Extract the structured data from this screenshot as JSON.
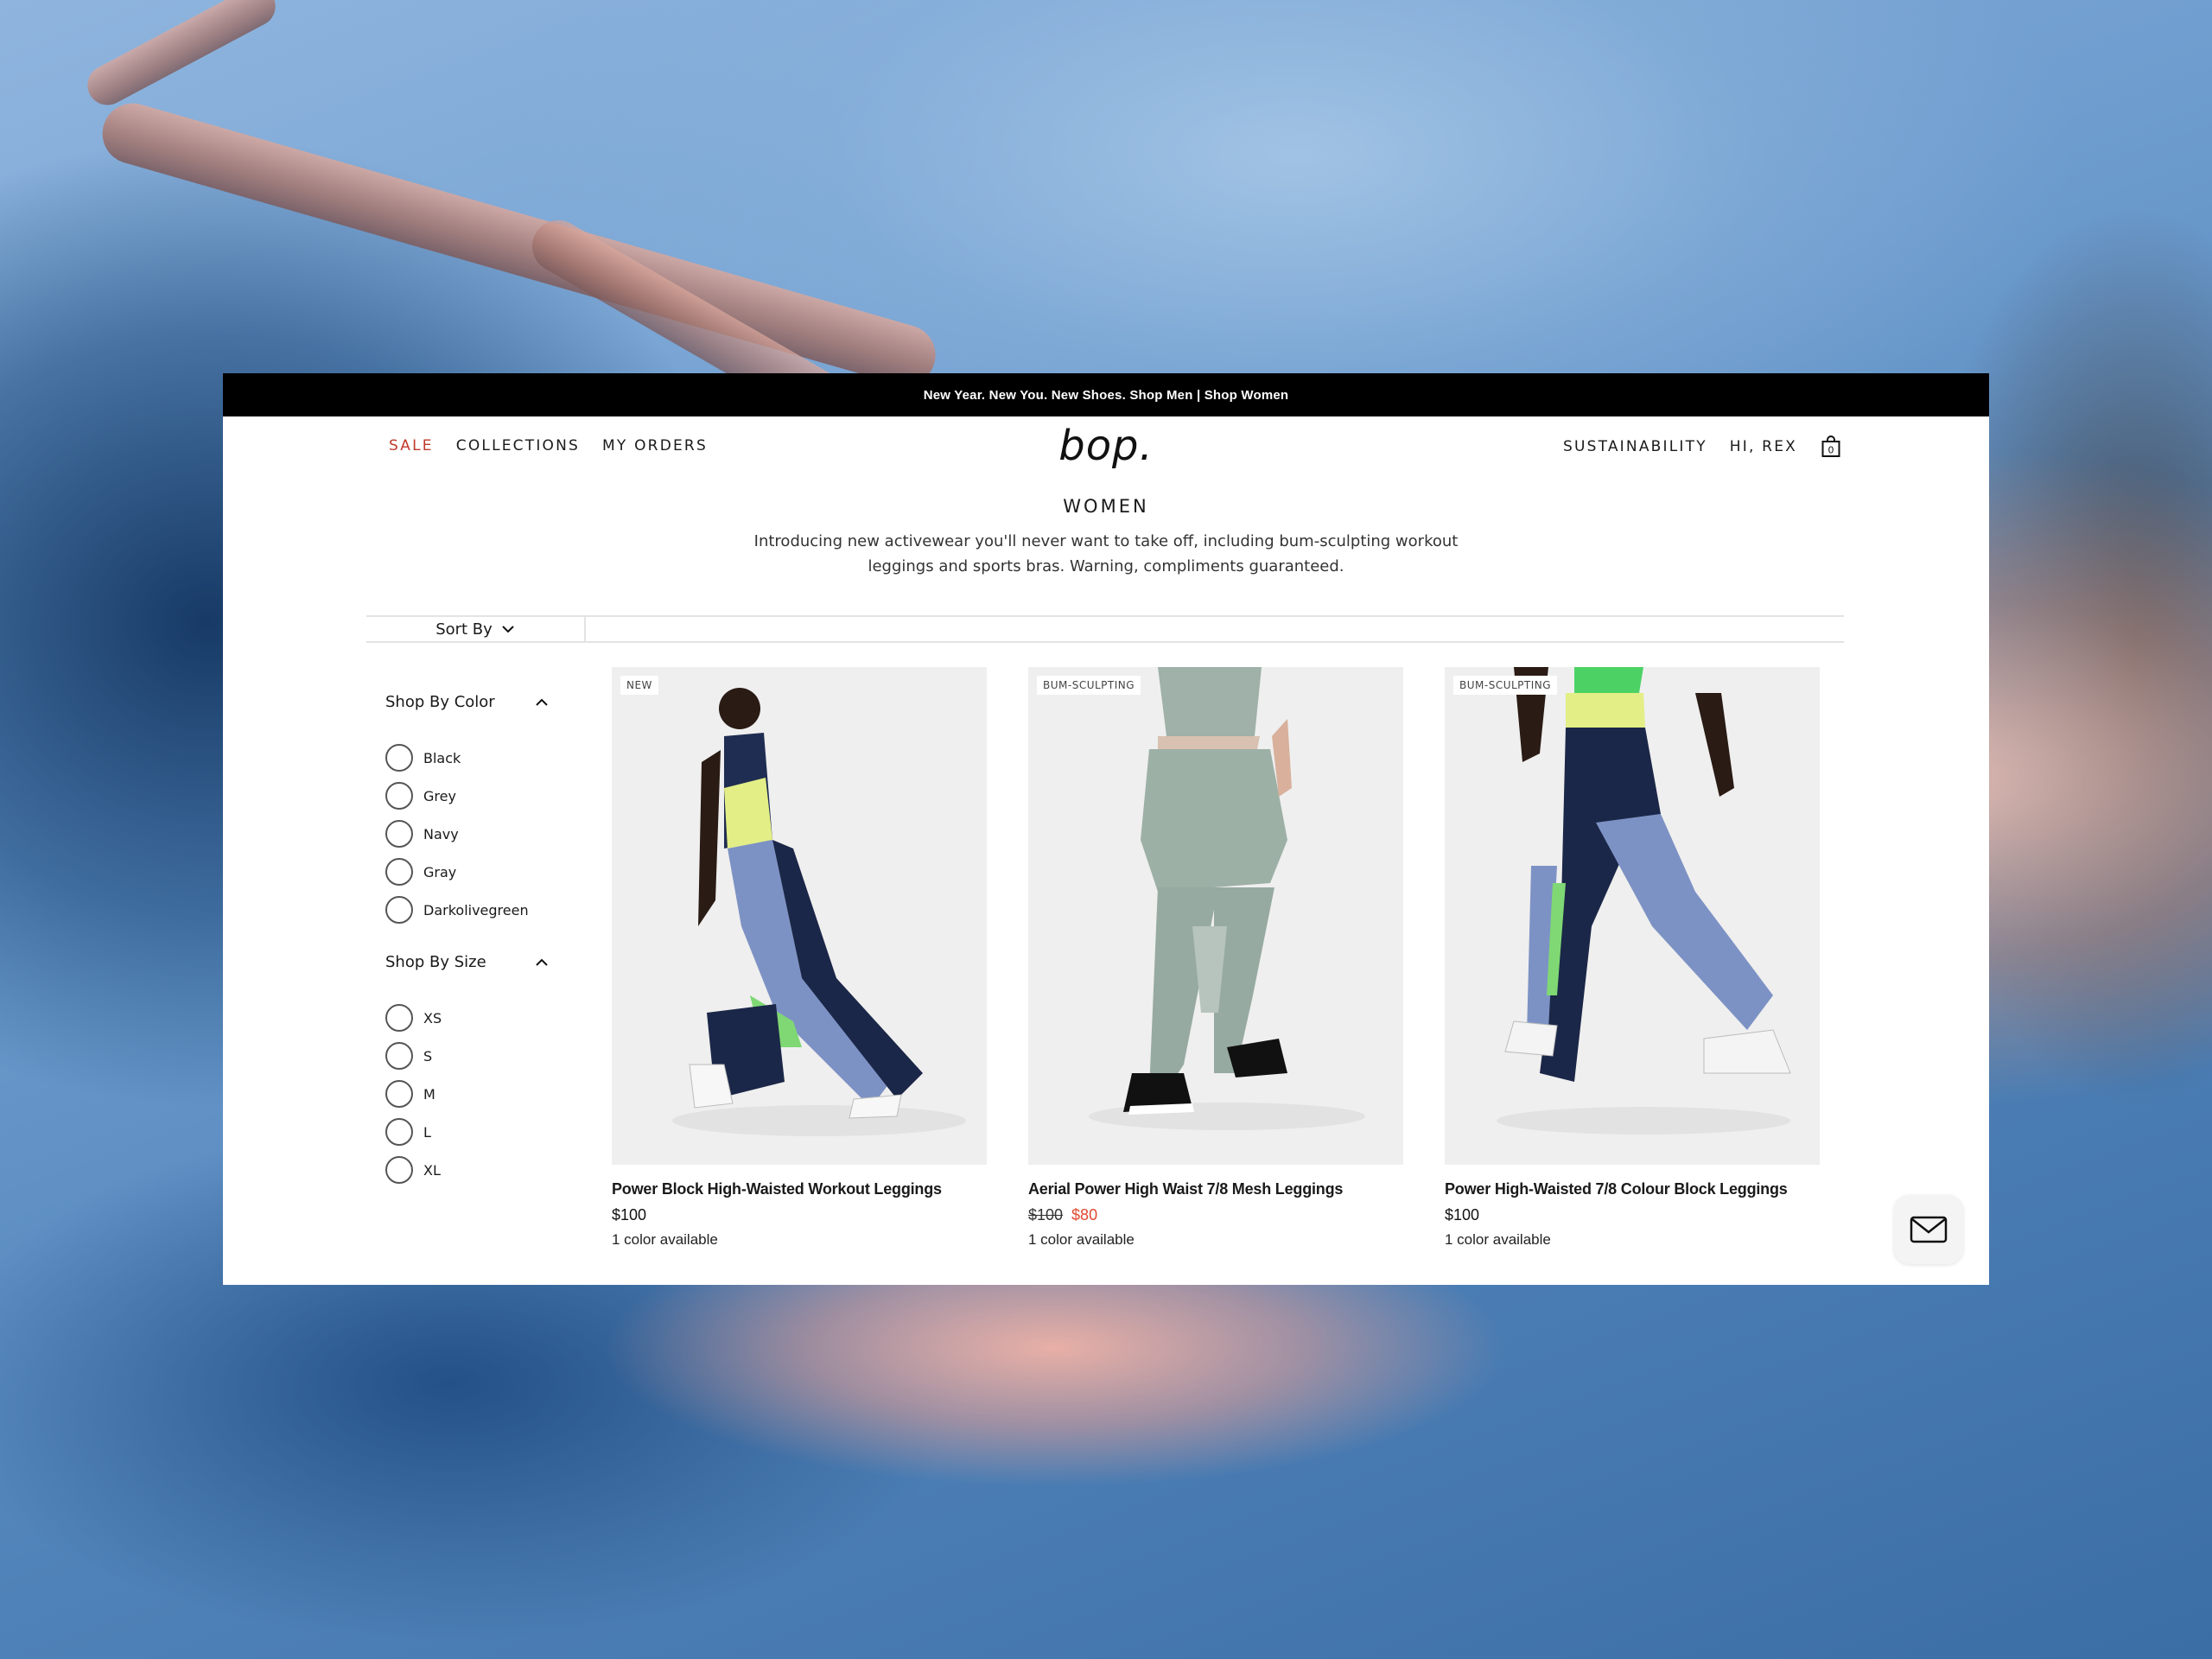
{
  "promo": {
    "text": "New Year. New You. New Shoes. Shop Men | Shop Women"
  },
  "nav": {
    "left": [
      "SALE",
      "COLLECTIONS",
      "MY ORDERS"
    ],
    "logo": "bop.",
    "right": [
      "SUSTAINABILITY",
      "HI, REX"
    ],
    "cart_count": "0"
  },
  "page": {
    "title": "WOMEN",
    "description": "Introducing new activewear you'll never want to take off, including bum-sculpting workout leggings and sports bras. Warning, compliments guaranteed."
  },
  "sort": {
    "label": "Sort By"
  },
  "filters": {
    "color": {
      "title": "Shop By Color",
      "options": [
        "Black",
        "Grey",
        "Navy",
        "Gray",
        "Darkolivegreen"
      ]
    },
    "size": {
      "title": "Shop By Size",
      "options": [
        "XS",
        "S",
        "M",
        "L",
        "XL"
      ]
    }
  },
  "products": [
    {
      "badge": "NEW",
      "title": "Power Block High-Waisted Workout Leggings",
      "price": "$100",
      "old_price": "",
      "colors": "1 color available"
    },
    {
      "badge": "BUM-SCULPTING",
      "title": "Aerial Power High Waist 7/8 Mesh Leggings",
      "price": "$80",
      "old_price": "$100",
      "colors": "1 color available"
    },
    {
      "badge": "BUM-SCULPTING",
      "title": "Power High-Waisted 7/8 Colour Block Leggings",
      "price": "$100",
      "old_price": "",
      "colors": "1 color available"
    }
  ],
  "colors": {
    "sale": "#c0392b",
    "sale_price": "#e04a2f",
    "promo_bg": "#000000"
  },
  "icons": {
    "cart": "shopping-bag-icon",
    "sort": "chevron-down-icon",
    "filter_toggle": "chevron-up-icon",
    "mail": "mail-icon"
  }
}
